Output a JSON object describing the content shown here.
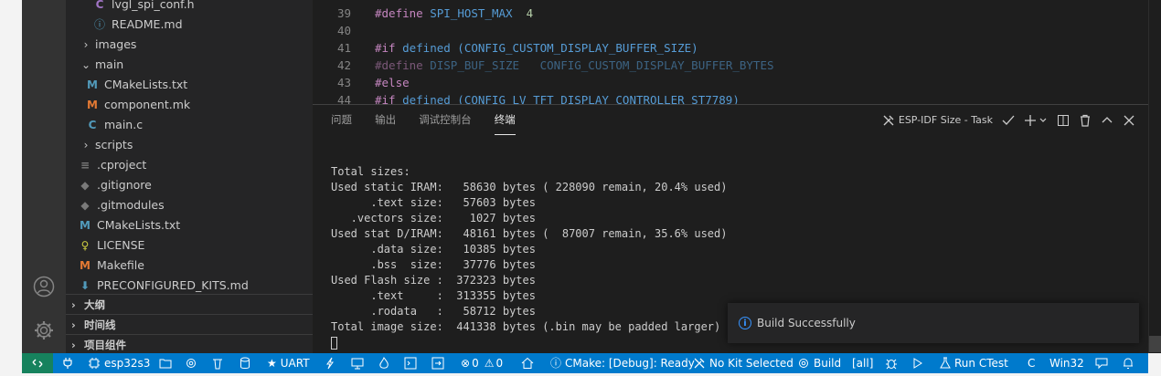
{
  "explorer": {
    "items": [
      {
        "label": "lvgl_spi_conf.h",
        "icon": "C"
      },
      {
        "label": "README.md",
        "icon": "ⓘ"
      },
      {
        "label": "images"
      },
      {
        "label": "main"
      },
      {
        "label": "CMakeLists.txt",
        "icon": "M"
      },
      {
        "label": "component.mk",
        "icon": "M"
      },
      {
        "label": "main.c",
        "icon": "C"
      },
      {
        "label": "scripts"
      },
      {
        "label": ".cproject",
        "icon": "≡"
      },
      {
        "label": ".gitignore",
        "icon": "◆"
      },
      {
        "label": ".gitmodules",
        "icon": "◆"
      },
      {
        "label": "CMakeLists.txt",
        "icon": "M"
      },
      {
        "label": "LICENSE",
        "icon": "♀"
      },
      {
        "label": "Makefile",
        "icon": "M"
      },
      {
        "label": "PRECONFIGURED_KITS.md",
        "icon": "⬇"
      }
    ],
    "sections": [
      "大纲",
      "时间线",
      "项目组件"
    ]
  },
  "editor": {
    "lines": [
      {
        "num": "39",
        "kw": "#define",
        "rest": " SPI_HOST_MAX",
        "val": "  4"
      },
      {
        "num": "40",
        "kw": "",
        "rest": "",
        "val": ""
      },
      {
        "num": "41",
        "kw": "#if",
        "rest": " defined (CONFIG_CUSTOM_DISPLAY_BUFFER_SIZE)",
        "val": ""
      },
      {
        "num": "42",
        "kw": "#define",
        "rest": " DISP_BUF_SIZE   CONFIG_CUSTOM_DISPLAY_BUFFER_BYTES",
        "val": ""
      },
      {
        "num": "43",
        "kw": "#else",
        "rest": "",
        "val": ""
      },
      {
        "num": "44",
        "kw": "#if",
        "rest": " defined (CONFIG_LV_TFT_DISPLAY_CONTROLLER_ST7789)",
        "val": ""
      }
    ]
  },
  "panel": {
    "tabs": [
      "问题",
      "输出",
      "调试控制台",
      "终端"
    ],
    "task_label": "ESP-IDF Size - Task"
  },
  "terminal": {
    "lines": [
      "Total sizes:",
      "Used static IRAM:   58630 bytes ( 228090 remain, 20.4% used)",
      "      .text size:   57603 bytes",
      "   .vectors size:    1027 bytes",
      "Used stat D/IRAM:   48161 bytes (  87007 remain, 35.6% used)",
      "      .data size:   10385 bytes",
      "      .bss  size:   37776 bytes",
      "Used Flash size :  372323 bytes",
      "      .text     :  313355 bytes",
      "      .rodata   :   58712 bytes",
      "Total image size:  441338 bytes (.bin may be padded larger)"
    ]
  },
  "notification": {
    "message": "Build Successfully"
  },
  "statusbar": {
    "target": "esp32s3",
    "uart": "UART",
    "problems_errors": "0",
    "problems_warnings": "0",
    "cmake": "CMake: [Debug]: Ready",
    "kit": "No Kit Selected",
    "build": "Build",
    "all": "[all]",
    "ctest": "Run CTest",
    "lang": "C",
    "platform": "Win32"
  },
  "colors": {
    "statusbar": "#007acc",
    "remote": "#16825d",
    "sidebar": "#252526",
    "editor": "#1e1e1e"
  }
}
